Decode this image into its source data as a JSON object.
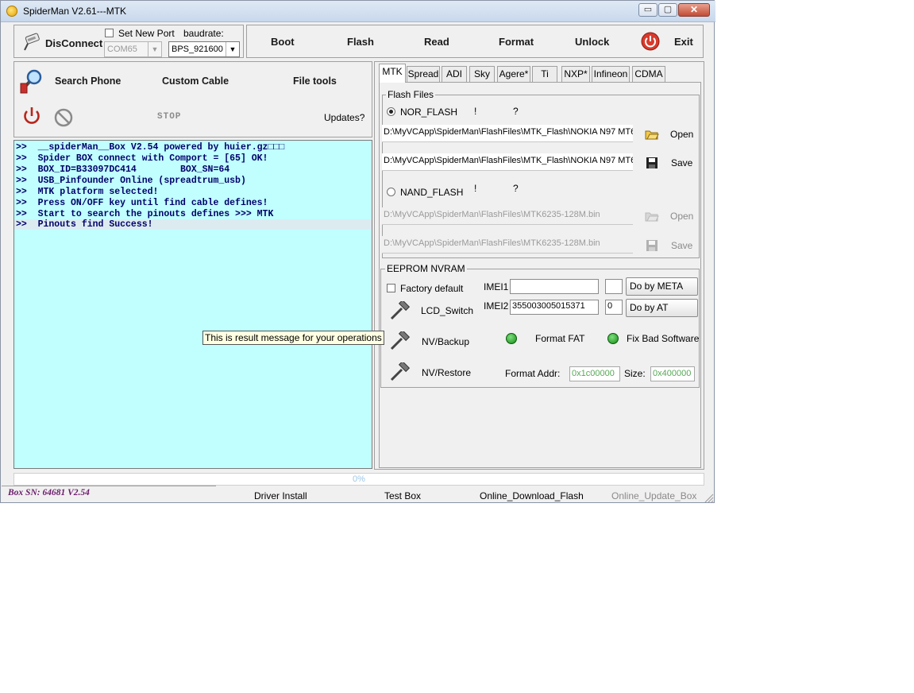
{
  "window": {
    "title": "SpiderMan V2.61---MTK",
    "min": "▭",
    "max": "▢",
    "close": "✕"
  },
  "connection": {
    "disconnect_label": "DisConnect",
    "set_new_port_label": "Set New Port",
    "baudrate_label": "baudrate:",
    "port_value": "COM65",
    "baud_value": "BPS_921600"
  },
  "toolbar": {
    "boot": "Boot",
    "flash": "Flash",
    "read": "Read",
    "format": "Format",
    "unlock": "Unlock",
    "exit": "Exit"
  },
  "tools": {
    "search_phone": "Search Phone",
    "custom_cable": "Custom Cable",
    "file_tools": "File tools",
    "stop": "STOP",
    "updates": "Updates?"
  },
  "console_lines": [
    ">>  __spiderMan__Box V2.54 powered by huier.gz□□□",
    ">>  Spider BOX connect with Comport = [65] OK!",
    ">>  BOX_ID=B33097DC414        BOX_SN=64",
    ">>  USB_Pinfounder Online (spreadtrum_usb)",
    ">>  MTK platform selected!",
    ">>  Press ON/OFF key until find cable defines!",
    ">>  Start to search the pinouts defines >>> MTK",
    ">>  Pinouts find Success!"
  ],
  "tooltip": "This is result message for your operations",
  "tabs": [
    "MTK",
    "Spread",
    "ADI",
    "Sky",
    "Agere*",
    "Ti",
    "NXP*",
    "Infineon",
    "CDMA"
  ],
  "flash_files": {
    "group_label": "Flash Files",
    "nor_label": "NOR_FLASH",
    "nor_excl": "!",
    "nor_q": "?",
    "nor_path1": "D:\\MyVCApp\\SpiderMan\\FlashFiles\\MTK_Flash\\NOKIA N97 MT6",
    "nor_path2": "D:\\MyVCApp\\SpiderMan\\FlashFiles\\MTK_Flash\\NOKIA N97 MT6",
    "open": "Open",
    "save": "Save",
    "nand_label": "NAND_FLASH",
    "nand_excl": "!",
    "nand_q": "?",
    "nand_path1": "D:\\MyVCApp\\SpiderMan\\FlashFiles\\MTK6235-128M.bin",
    "nand_path2": "D:\\MyVCApp\\SpiderMan\\FlashFiles\\MTK6235-128M.bin"
  },
  "eeprom": {
    "group_label": "EEPROM NVRAM",
    "factory_default": "Factory default",
    "imei1_label": "IMEI1",
    "imei1_value": "",
    "imei1_small": "",
    "do_by_meta": "Do by META",
    "lcd_switch": "LCD_Switch",
    "imei2_label": "IMEI2",
    "imei2_value": "355003005015371",
    "imei2_small": "0",
    "do_by_at": "Do by AT",
    "nv_backup": "NV/Backup",
    "format_fat": "Format FAT",
    "fix_bad_software": "Fix Bad Software",
    "nv_restore": "NV/Restore",
    "format_addr_label": "Format Addr:",
    "format_addr_value": "0x1c00000",
    "size_label": "Size:",
    "size_value": "0x400000"
  },
  "progress": {
    "percent_label": "0%",
    "percent": 0
  },
  "status": {
    "box_sn": "Box SN: 64681   V2.54",
    "driver_install": "Driver Install",
    "test_box": "Test Box",
    "online_download_flash": "Online_Download_Flash",
    "online_update_box": "Online_Update_Box"
  }
}
